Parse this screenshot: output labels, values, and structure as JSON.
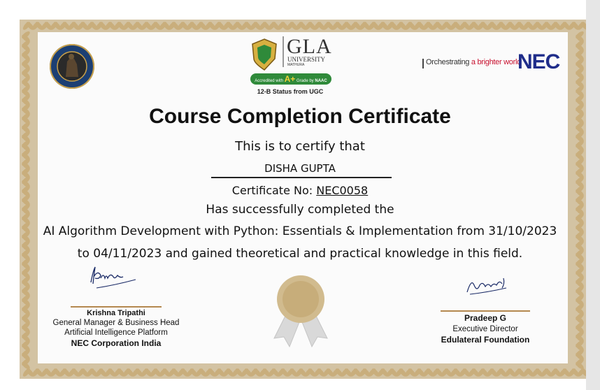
{
  "colors": {
    "frame": "#d3c3a3",
    "leaf": "#c9ae7c",
    "accent_rule": "#b4884f",
    "nec_blue": "#1f2d8a",
    "nec_red": "#c8102e",
    "gla_green": "#2f8a3a"
  },
  "logos": {
    "edulateral": {
      "text_top": "EDULATERAL FOUNDATION",
      "text_bottom": "IDEATE • INNOVATE • INTEGRATE"
    },
    "gla": {
      "big": "GLA",
      "university": "UNIVERSITY",
      "city": "MATHURA",
      "recognized": "Recognised by UGC Under Section 2(f)",
      "badge_pre": "Accredited with",
      "badge_grade": "A+",
      "badge_post": "Grade by",
      "badge_naac": "NAAC",
      "ugc_status": "12-B Status from UGC"
    },
    "nec": {
      "tagline_pre": "Orchestrating",
      "tagline_mid": " a brighter world",
      "wordmark": "NEC"
    }
  },
  "certificate": {
    "title": "Course Completion Certificate",
    "certify_line": "This is to certify that",
    "recipient": "DISHA GUPTA",
    "cert_no_label": "Certificate No: ",
    "cert_no_value": "NEC0058",
    "completed_line": "Has successfully completed the",
    "course_line_1": "AI Algorithm Development with Python: Essentials & Implementation from 31/10/2023",
    "course_line_2": "to 04/11/2023 and gained theoretical and practical knowledge in this field."
  },
  "signatories": {
    "left": {
      "signature": "Krishna",
      "name": "Krishna Tripathi",
      "role_1": "General Manager & Business Head",
      "role_2": "Artificial Intelligence Platform",
      "org": "NEC Corporation India"
    },
    "right": {
      "signature": "Pradeep G",
      "name": "Pradeep G",
      "role_1": "Executive Director",
      "org": "Edulateral Foundation"
    }
  }
}
